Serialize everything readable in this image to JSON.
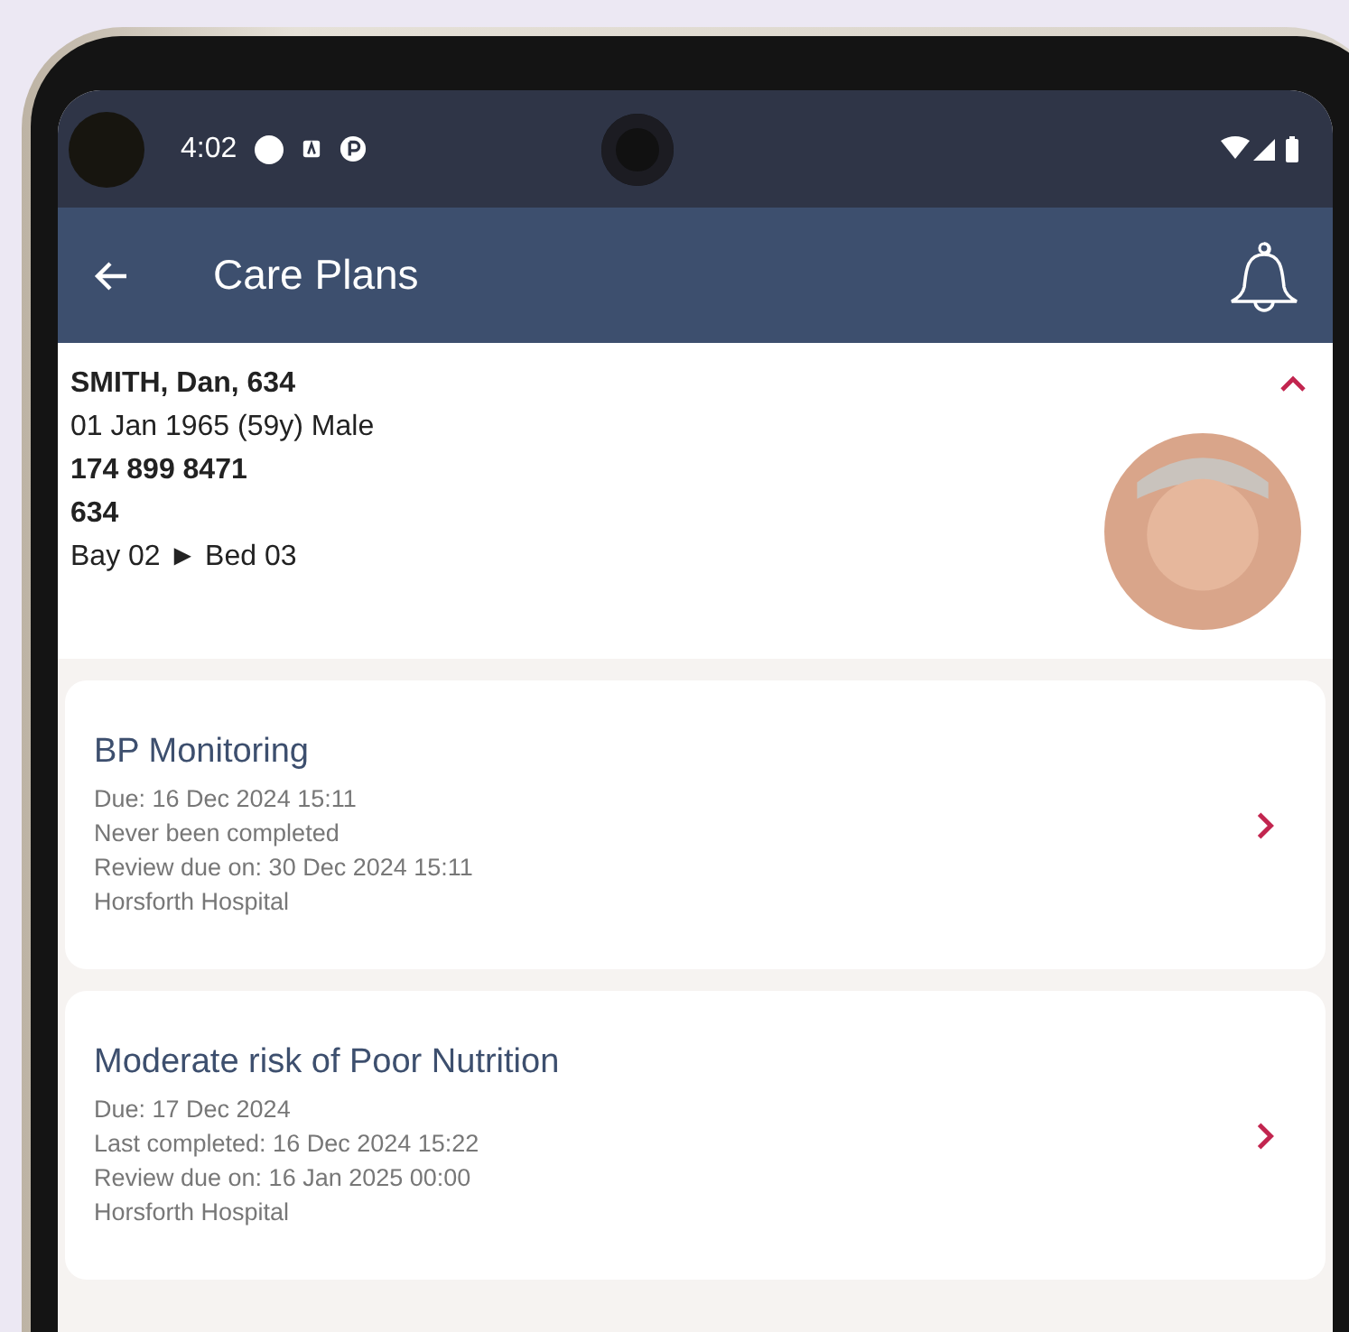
{
  "status_bar": {
    "time": "4:02"
  },
  "app_bar": {
    "title": "Care Plans"
  },
  "patient": {
    "name": "SMITH, Dan, 634",
    "details": "01 Jan 1965 (59y) Male",
    "nhs_number": "174 899 8471",
    "id": "634",
    "location": "Bay 02 ► Bed 03",
    "expanded": true
  },
  "care_plans": [
    {
      "title": "BP Monitoring",
      "lines": [
        "Due: 16 Dec 2024 15:11",
        "Never been completed",
        "Review due on: 30 Dec 2024 15:11",
        "Horsforth Hospital"
      ]
    },
    {
      "title": "Moderate risk of Poor Nutrition",
      "lines": [
        "Due: 17 Dec 2024",
        "Last completed: 16 Dec 2024 15:22",
        "Review due on: 16 Jan 2025 00:00",
        "Horsforth Hospital"
      ]
    }
  ]
}
